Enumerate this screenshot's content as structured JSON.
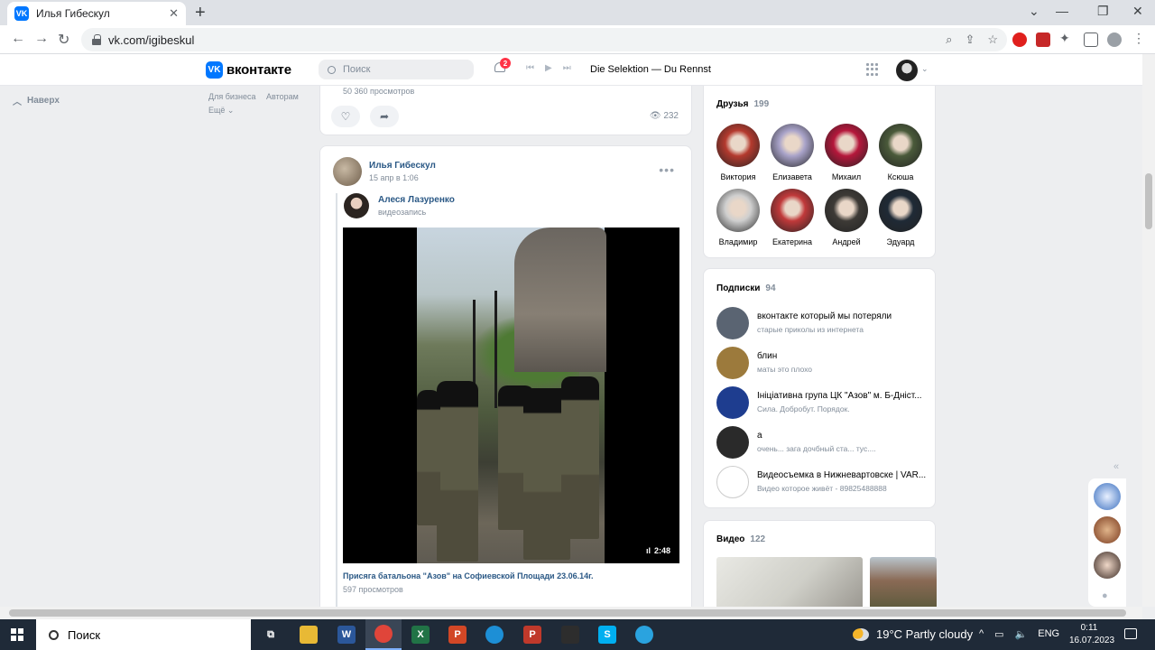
{
  "browser": {
    "tab_title": "Илья Гибескул",
    "tab_close": "✕",
    "new_tab": "+",
    "url": "vk.com/igibeskul",
    "favicon_text": "VK"
  },
  "header": {
    "logo_text": "VK",
    "site_name": "вконтакте",
    "search_placeholder": "Поиск",
    "notifications_count": "2",
    "track": "Die Selektion — Du Rennst"
  },
  "left": {
    "back_up": "Наверх",
    "links": [
      "Для бизнеса",
      "Авторам",
      "Ещё ⌄"
    ]
  },
  "prev_post": {
    "views": "50 360 просмотров",
    "view_count": "232"
  },
  "post": {
    "author": "Илья Гибескул",
    "date": "15 апр в 1:06",
    "more": "•••",
    "repost_author": "Алеся Лазуренко",
    "repost_type": "видеозапись",
    "video_duration": "2:48",
    "video_title": "Присяга батальона \"Азов\" на Софиевской Площади 23.06.14г.",
    "video_views": "597 просмотров"
  },
  "friends": {
    "title": "Друзья",
    "count": "199",
    "items": [
      {
        "name": "Виктория",
        "color": "#b43a2e"
      },
      {
        "name": "Елизавета",
        "color": "#a9a3c9"
      },
      {
        "name": "Михаил",
        "color": "#b5173b"
      },
      {
        "name": "Ксюша",
        "color": "#4a5a3a"
      },
      {
        "name": "Владимир",
        "color": "#cfcfcf"
      },
      {
        "name": "Екатерина",
        "color": "#c0393a"
      },
      {
        "name": "Андрей",
        "color": "#3d3a36"
      },
      {
        "name": "Эдуард",
        "color": "#1f2a36"
      }
    ]
  },
  "subscriptions": {
    "title": "Подписки",
    "count": "94",
    "items": [
      {
        "name": "вконтакте который мы потеряли",
        "desc": "старые приколы из интернета",
        "color": "#5a6472"
      },
      {
        "name": "блин",
        "desc": "маты это плохо",
        "color": "#9c7a3c"
      },
      {
        "name": "Ініціативна група ЦК \"Азов\" м. Б-Дніст...",
        "desc": "Сила. Добробут. Порядок.",
        "color": "#1e3d8f"
      },
      {
        "name": "а",
        "desc": "очень... зага дочбный ста... тус....",
        "color": "#2a2a2a"
      },
      {
        "name": "Видеосъемка в Нижневартовске | VAR...",
        "desc": "Видео которое живёт - 89825488888",
        "color": "#ffffff"
      }
    ]
  },
  "videos": {
    "title": "Видео",
    "count": "122"
  },
  "taskbar": {
    "search": "Поиск",
    "weather": "19°C  Partly cloudy",
    "lang": "ENG",
    "time": "0:11",
    "date": "16.07.2023",
    "apps": [
      {
        "name": "task-view",
        "label": "⧉",
        "color": "#1f2a38"
      },
      {
        "name": "file-explorer",
        "label": "",
        "color": "#e8b935"
      },
      {
        "name": "word",
        "label": "W",
        "color": "#2b579a"
      },
      {
        "name": "chrome",
        "label": "",
        "color": "#e0453a"
      },
      {
        "name": "excel",
        "label": "X",
        "color": "#217346"
      },
      {
        "name": "powerpoint",
        "label": "P",
        "color": "#d24726"
      },
      {
        "name": "edge",
        "label": "",
        "color": "#1d8fd6"
      },
      {
        "name": "app-p",
        "label": "P",
        "color": "#c0392b"
      },
      {
        "name": "game-app",
        "label": "",
        "color": "#2d2d2d"
      },
      {
        "name": "skype",
        "label": "S",
        "color": "#00aff0"
      },
      {
        "name": "telegram",
        "label": "",
        "color": "#2aa3df"
      }
    ]
  }
}
